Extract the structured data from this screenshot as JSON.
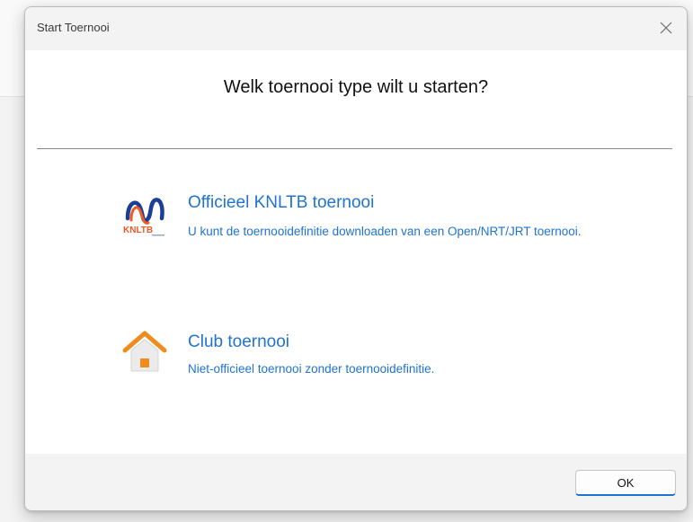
{
  "dialog": {
    "title": "Start Toernooi",
    "heading": "Welk toernooi type wilt u starten?",
    "close_icon": "close-icon"
  },
  "options": [
    {
      "title": "Officieel KNLTB toernooi",
      "description": "U kunt de toernooidefinitie downloaden van een Open/NRT/JRT toernooi.",
      "icon": "knltb-logo",
      "logo_text": "KNLTB"
    },
    {
      "title": "Club toernooi",
      "description": "Niet-officieel toernooi zonder toernooidefinitie.",
      "icon": "house-icon"
    }
  ],
  "footer": {
    "ok_label": "OK"
  },
  "colors": {
    "link_blue": "#1f73d1",
    "knltb_blue": "#1b3f95",
    "knltb_orange": "#f05a22",
    "house_orange": "#f08c1e"
  }
}
